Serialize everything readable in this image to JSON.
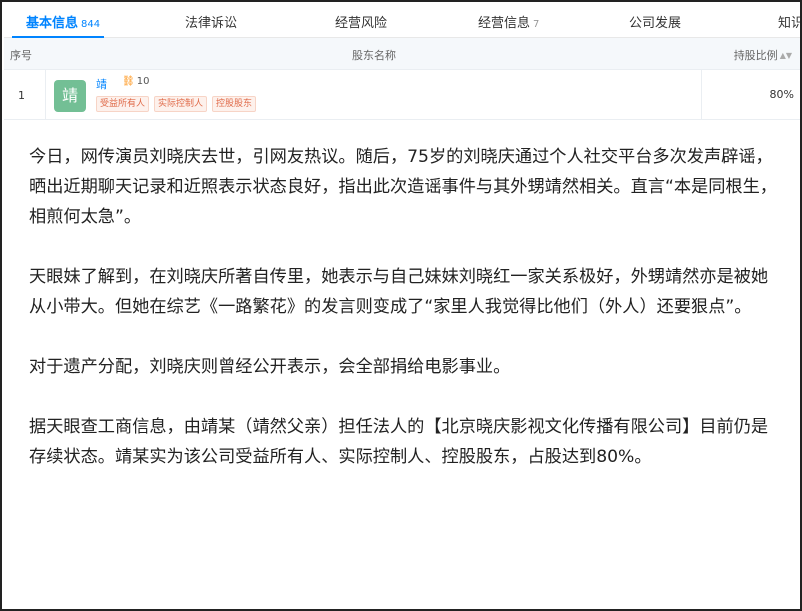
{
  "tabs": [
    {
      "label": "基本信息",
      "count": "844"
    },
    {
      "label": "法律诉讼",
      "count": ""
    },
    {
      "label": "经营风险",
      "count": ""
    },
    {
      "label": "经营信息",
      "count": "7"
    },
    {
      "label": "公司发展",
      "count": ""
    },
    {
      "label": "知识",
      "count": ""
    }
  ],
  "table": {
    "headers": {
      "no": "序号",
      "name": "股东名称",
      "pct": "持股比例"
    },
    "rows": [
      {
        "no": "1",
        "avatar_char": "靖",
        "name": "靖",
        "link_count": "10",
        "tags": [
          "受益所有人",
          "实际控制人",
          "控股股东"
        ],
        "pct": "80%"
      }
    ]
  },
  "article": {
    "paragraphs": [
      "今日，网传演员刘晓庆去世，引网友热议。随后，75岁的刘晓庆通过个人社交平台多次发声辟谣，晒出近期聊天记录和近照表示状态良好，指出此次造谣事件与其外甥靖然相关。直言“本是同根生，相煎何太急”。",
      "天眼妹了解到，在刘晓庆所著自传里，她表示与自己妹妹刘晓红一家关系极好，外甥靖然亦是被她从小带大。但她在综艺《一路繁花》的发言则变成了“家里人我觉得比他们（外人）还要狠点”。",
      "对于遗产分配，刘晓庆则曾经公开表示，会全部捐给电影事业。",
      "据天眼查工商信息，由靖某（靖然父亲）担任法人的【北京晓庆影视文化传播有限公司】目前仍是存续状态。靖某实为该公司受益所有人、实际控制人、控股股东，占股达到80%。"
    ]
  },
  "colors": {
    "accent": "#0084ff",
    "avatar_bg": "#73bf95",
    "tag_text": "#e06b4a"
  }
}
